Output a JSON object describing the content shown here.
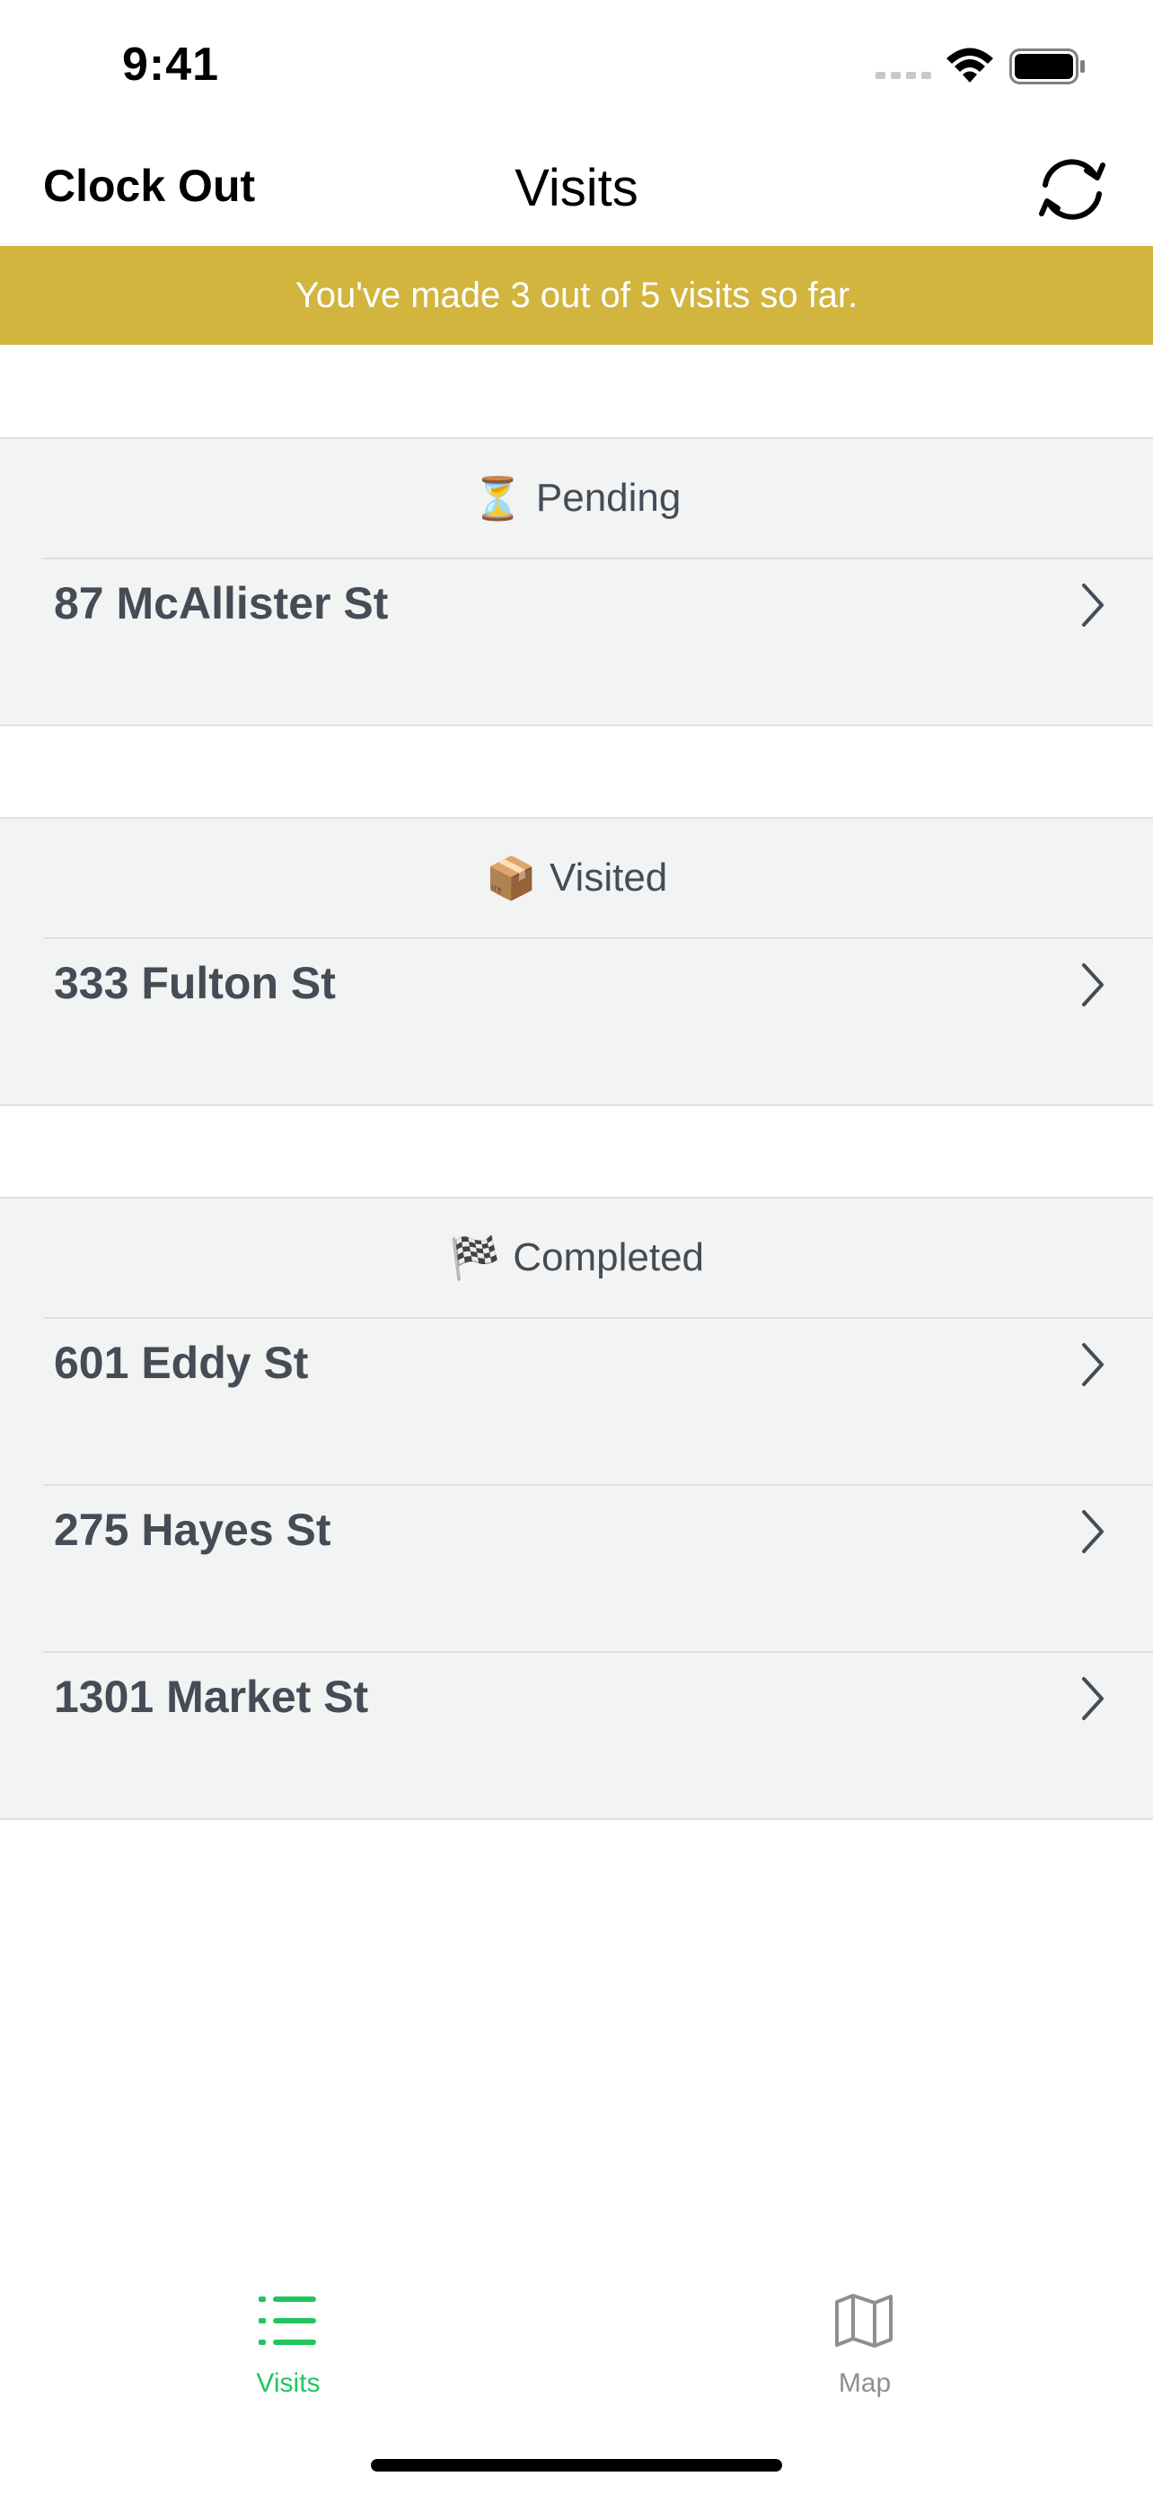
{
  "status_bar": {
    "time": "9:41"
  },
  "nav": {
    "left_button": "Clock Out",
    "title": "Visits",
    "right_icon": "sync-icon"
  },
  "banner": {
    "text": "You've made 3 out of 5 visits so far.",
    "color": "#d1b53e"
  },
  "sections": [
    {
      "emoji": "⏳",
      "title": "Pending",
      "items": [
        "87 McAllister St"
      ]
    },
    {
      "emoji": "📦",
      "title": "Visited",
      "items": [
        "333 Fulton St"
      ]
    },
    {
      "emoji": "🏁",
      "title": "Completed",
      "items": [
        "601 Eddy St",
        "275 Hayes St",
        "1301 Market St"
      ]
    }
  ],
  "tab_bar": {
    "tabs": [
      {
        "label": "Visits",
        "icon": "list-icon",
        "active": true,
        "color": "#22c55e"
      },
      {
        "label": "Map",
        "icon": "map-icon",
        "active": false,
        "color": "#8e8e93"
      }
    ]
  }
}
